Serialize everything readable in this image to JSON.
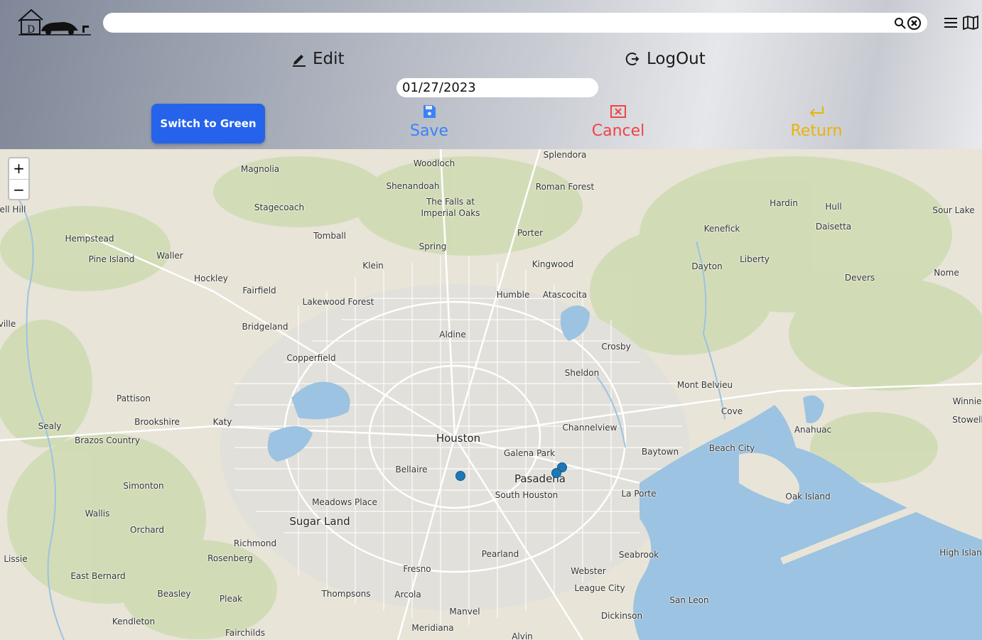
{
  "header": {
    "logo_icon": "garage-car-logo-icon",
    "search": {
      "value": "",
      "placeholder": "",
      "search_icon": "magnifier-icon",
      "clear_icon": "circle-x-icon"
    },
    "menu_icon": "hamburger-menu-icon",
    "map_icon": "folded-map-icon",
    "edit_label": "Edit",
    "logout_label": "LogOut",
    "date_value": "01/27/2023",
    "switch_label": "Switch to Green",
    "save_label": "Save",
    "cancel_label": "Cancel",
    "return_label": "Return",
    "colors": {
      "switch_bg": "#2563eb",
      "save": "#3b82f6",
      "cancel": "#ef4444",
      "return": "#eab308"
    }
  },
  "map": {
    "zoom_in_label": "+",
    "zoom_out_label": "−",
    "places": [
      {
        "name": "Splendora"
      },
      {
        "name": "Woodloch"
      },
      {
        "name": "Magnolia"
      },
      {
        "name": "Shenandoah"
      },
      {
        "name": "Roman Forest"
      },
      {
        "name": "The Falls at"
      },
      {
        "name": "Imperial Oaks"
      },
      {
        "name": "Stagecoach"
      },
      {
        "name": "Hardin"
      },
      {
        "name": "Hull"
      },
      {
        "name": "Sour Lake"
      },
      {
        "name": "ell Hill"
      },
      {
        "name": "Daisetta"
      },
      {
        "name": "Kenefick"
      },
      {
        "name": "Porter"
      },
      {
        "name": "Tomball"
      },
      {
        "name": "Hempstead"
      },
      {
        "name": "Spring"
      },
      {
        "name": "Pine Island"
      },
      {
        "name": "Waller"
      },
      {
        "name": "Liberty"
      },
      {
        "name": "Klein"
      },
      {
        "name": "Kingwood"
      },
      {
        "name": "Dayton"
      },
      {
        "name": "Nome"
      },
      {
        "name": "Hockley"
      },
      {
        "name": "Devers"
      },
      {
        "name": "Fairfield"
      },
      {
        "name": "Humble"
      },
      {
        "name": "Atascocita"
      },
      {
        "name": "Lakewood Forest"
      },
      {
        "name": "ville"
      },
      {
        "name": "Bridgeland"
      },
      {
        "name": "Aldine"
      },
      {
        "name": "Crosby"
      },
      {
        "name": "Copperfield"
      },
      {
        "name": "Sheldon"
      },
      {
        "name": "Mont Belvieu"
      },
      {
        "name": "Pattison"
      },
      {
        "name": "Winnie"
      },
      {
        "name": "Cove"
      },
      {
        "name": "Stowell"
      },
      {
        "name": "Katy"
      },
      {
        "name": "Brookshire"
      },
      {
        "name": "Sealy"
      },
      {
        "name": "Channelview"
      },
      {
        "name": "Anahuac"
      },
      {
        "name": "Houston"
      },
      {
        "name": "Brazos Country"
      },
      {
        "name": "Beach City"
      },
      {
        "name": "Baytown"
      },
      {
        "name": "Galena Park"
      },
      {
        "name": "Bellaire"
      },
      {
        "name": "Pasadena"
      },
      {
        "name": "Simonton"
      },
      {
        "name": "La Porte"
      },
      {
        "name": "South Houston"
      },
      {
        "name": "Oak Island"
      },
      {
        "name": "Meadows Place"
      },
      {
        "name": "Wallis"
      },
      {
        "name": "Sugar Land"
      },
      {
        "name": "Orchard"
      },
      {
        "name": "Richmond"
      },
      {
        "name": "Pearland"
      },
      {
        "name": "Seabrook"
      },
      {
        "name": "High Islan"
      },
      {
        "name": "Rosenberg"
      },
      {
        "name": "Lissie"
      },
      {
        "name": "Fresno"
      },
      {
        "name": "Webster"
      },
      {
        "name": "East Bernard"
      },
      {
        "name": "League City"
      },
      {
        "name": "Beasley"
      },
      {
        "name": "Thompsons"
      },
      {
        "name": "Arcola"
      },
      {
        "name": "Pleak"
      },
      {
        "name": "San Leon"
      },
      {
        "name": "Manvel"
      },
      {
        "name": "Dickinson"
      },
      {
        "name": "Kendleton"
      },
      {
        "name": "Meridiana"
      },
      {
        "name": "Fairchilds"
      },
      {
        "name": "Alvin"
      }
    ]
  }
}
